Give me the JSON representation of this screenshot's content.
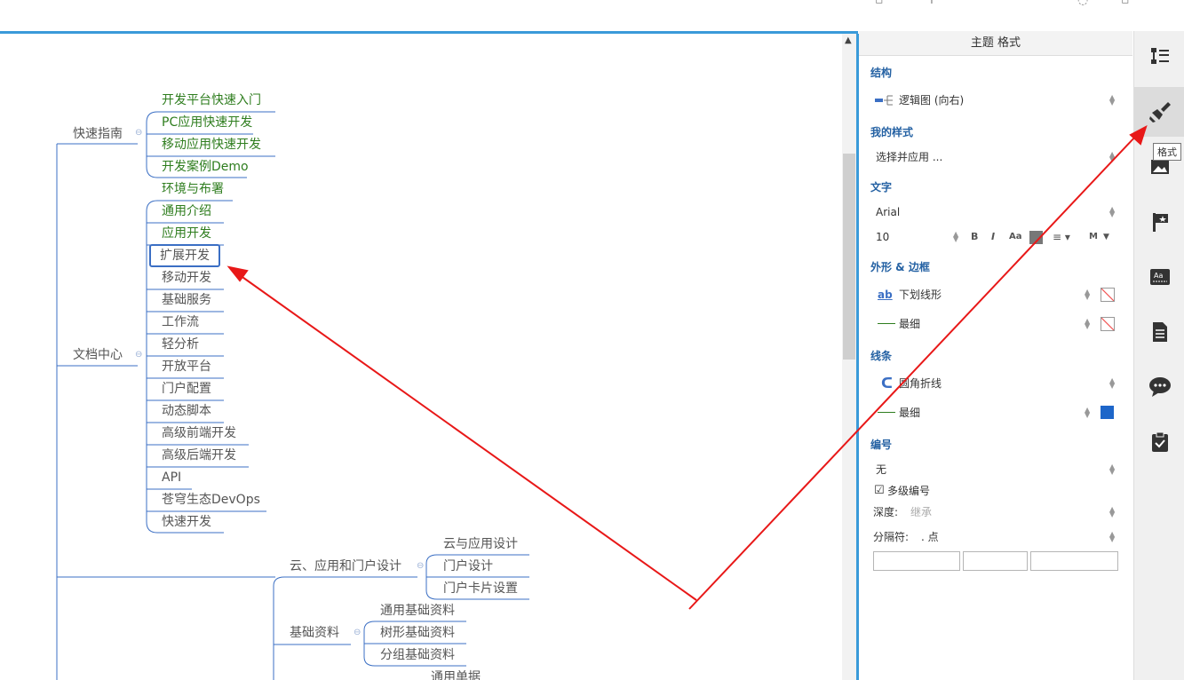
{
  "mindmap": {
    "guide": {
      "label": "快速指南",
      "children": [
        "开发平台快速入门",
        "PC应用快速开发",
        "移动应用快速开发",
        "开发案例Demo"
      ]
    },
    "docs": {
      "label": "文档中心",
      "children": [
        "环境与布署",
        "通用介绍",
        "应用开发",
        "扩展开发",
        "移动开发",
        "基础服务",
        "工作流",
        "轻分析",
        "开放平台",
        "门户配置",
        "动态脚本",
        "高级前端开发",
        "高级后端开发",
        "API",
        "苍穹生态DevOps",
        "快速开发"
      ]
    },
    "cloud": {
      "label": "云、应用和门户设计",
      "children": [
        "云与应用设计",
        "门户设计",
        "门户卡片设置"
      ]
    },
    "basic": {
      "label": "基础资料",
      "children": [
        "通用基础资料",
        "树形基础资料",
        "分组基础资料"
      ]
    },
    "partial_bottom": "通用单据",
    "collapse_glyph": "⊖"
  },
  "panel": {
    "title": "主题 格式",
    "structure": {
      "title": "结构",
      "value": "逻辑图 (向右)"
    },
    "my_style": {
      "title": "我的样式",
      "value": "选择并应用 ..."
    },
    "text": {
      "title": "文字",
      "font": "Arial",
      "size": "10",
      "bold": "B",
      "italic": "I",
      "case": "Aa",
      "more": "M"
    },
    "shape": {
      "title": "外形 & 边框",
      "shape_value": "下划线形",
      "shape_icon_text": "ab",
      "border_value": "最细"
    },
    "line": {
      "title": "线条",
      "style_value": "圆角折线",
      "width_value": "最细",
      "color": "#1d66c9"
    },
    "numbering": {
      "title": "编号",
      "value": "无",
      "multilevel": "多级编号",
      "depth_label": "深度:",
      "depth_value": "继承",
      "sep_label": "分隔符:",
      "sep_value": ". 点"
    }
  },
  "sidebar": {
    "tooltip": "格式",
    "items": [
      "outline-icon",
      "paintbrush-icon",
      "image-icon",
      "flag-icon",
      "text-style-icon",
      "document-icon",
      "comment-icon",
      "clipboard-check-icon"
    ]
  },
  "colors": {
    "accent": "#3a9ad9",
    "node_green": "#2e7d1e",
    "section_blue": "#2461a3",
    "arrow_red": "#e81818"
  }
}
